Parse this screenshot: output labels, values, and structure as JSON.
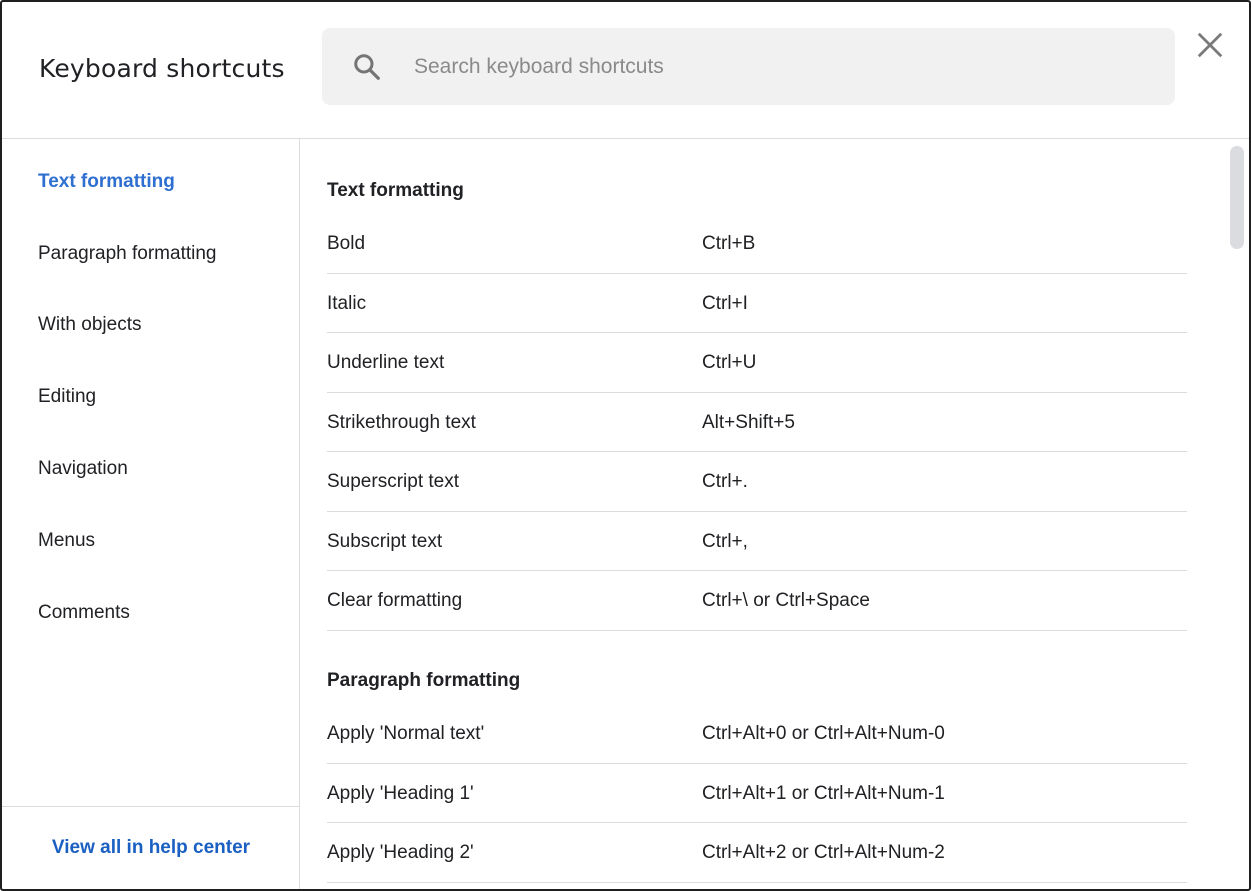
{
  "header": {
    "title": "Keyboard shortcuts",
    "search_placeholder": "Search keyboard shortcuts",
    "search_value": "",
    "close_icon": "close-icon",
    "search_icon": "search-icon"
  },
  "sidebar": {
    "items": [
      {
        "label": "Text formatting",
        "active": true
      },
      {
        "label": "Paragraph formatting",
        "active": false
      },
      {
        "label": "With objects",
        "active": false
      },
      {
        "label": "Editing",
        "active": false
      },
      {
        "label": "Navigation",
        "active": false
      },
      {
        "label": "Menus",
        "active": false
      },
      {
        "label": "Comments",
        "active": false
      }
    ],
    "footer_link": "View all in help center"
  },
  "sections": [
    {
      "title": "Text formatting",
      "rows": [
        {
          "action": "Bold",
          "keys": "Ctrl+B"
        },
        {
          "action": "Italic",
          "keys": "Ctrl+I"
        },
        {
          "action": "Underline text",
          "keys": "Ctrl+U"
        },
        {
          "action": "Strikethrough text",
          "keys": "Alt+Shift+5"
        },
        {
          "action": "Superscript text",
          "keys": "Ctrl+."
        },
        {
          "action": "Subscript text",
          "keys": "Ctrl+,"
        },
        {
          "action": "Clear formatting",
          "keys": "Ctrl+\\ or Ctrl+Space"
        }
      ]
    },
    {
      "title": "Paragraph formatting",
      "rows": [
        {
          "action": "Apply 'Normal text'",
          "keys": "Ctrl+Alt+0 or Ctrl+Alt+Num-0"
        },
        {
          "action": "Apply 'Heading 1'",
          "keys": "Ctrl+Alt+1 or Ctrl+Alt+Num-1"
        },
        {
          "action": "Apply 'Heading 2'",
          "keys": "Ctrl+Alt+2 or Ctrl+Alt+Num-2"
        }
      ]
    }
  ],
  "colors": {
    "accent": "#1a73e8",
    "link": "#1a5fc2",
    "text": "#202124",
    "divider": "#dadce0",
    "search_bg": "#f1f1f1"
  }
}
